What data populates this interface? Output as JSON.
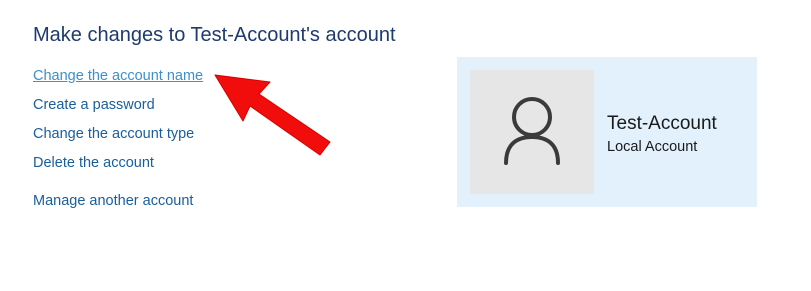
{
  "header": {
    "title": "Make changes to Test-Account's account"
  },
  "tasks": [
    {
      "label": "Change the account name"
    },
    {
      "label": "Create a password"
    },
    {
      "label": "Change the account type"
    },
    {
      "label": "Delete the account"
    },
    {
      "label": "Manage another account"
    }
  ],
  "account": {
    "name": "Test-Account",
    "type": "Local Account",
    "avatar_icon": "user-silhouette-icon"
  },
  "colors": {
    "title": "#1e3a6e",
    "link": "#1a5e9a",
    "link_hover": "#3f8fc9",
    "card_background": "#e3f1fc",
    "avatar_background": "#e6e6e6",
    "arrow": "#f20d0d"
  },
  "annotation": {
    "arrow_icon": "red-arrow-icon",
    "points_to": "Change the account name"
  }
}
